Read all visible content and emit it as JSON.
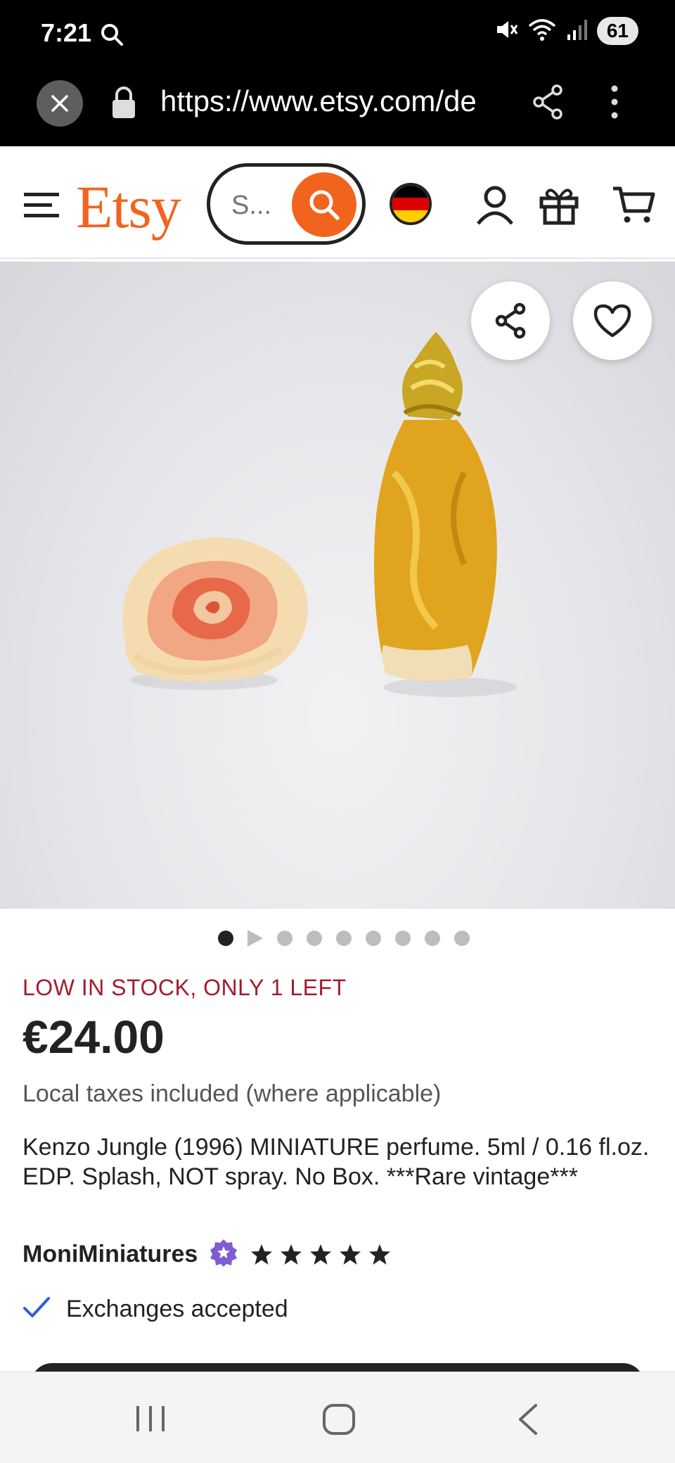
{
  "status_bar": {
    "time": "7:21",
    "battery": "61"
  },
  "browser": {
    "url": "https://www.etsy.com/de"
  },
  "header": {
    "logo": "Etsy",
    "search_placeholder": "S..."
  },
  "product": {
    "stock_notice": "LOW IN STOCK, ONLY 1 LEFT",
    "price": "€24.00",
    "tax_note": "Local taxes included (where applicable)",
    "title": "Kenzo Jungle (1996) MINIATURE perfume. 5ml / 0.16 fl.oz. EDP. Splash, NOT spray. No Box. ***Rare vintage***",
    "shop_name": "MoniMiniatures",
    "rating_stars": 5,
    "exchanges": "Exchanges accepted",
    "image_count": 9,
    "active_image": 1
  },
  "colors": {
    "brand": "#f1641e",
    "stock_warning": "#a61a2e",
    "check": "#2f5fd0",
    "star_seller": "#7f5ccf"
  }
}
